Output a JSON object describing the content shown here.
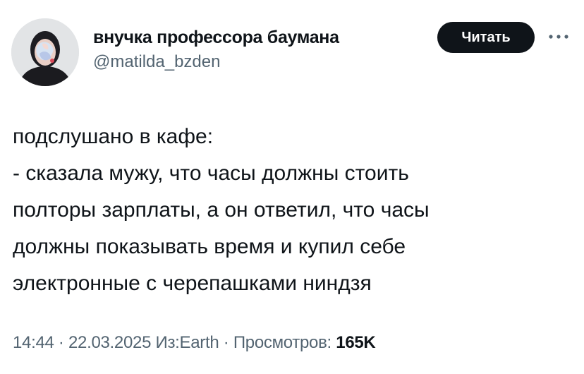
{
  "author": {
    "display_name": "внучка профессора баумана",
    "handle": "@matilda_bzden",
    "avatar_icon": "profile-photo-avatar"
  },
  "actions": {
    "follow_label": "Читать",
    "more_icon": "more-dots-icon"
  },
  "tweet": {
    "lines": [
      "подслушано в кафе:",
      "- сказала мужу, что часы должны стоить",
      "полторы зарплаты, а он ответил, что часы",
      "должны показывать время и купил себе",
      "электронные с черепашками ниндзя"
    ]
  },
  "meta": {
    "time": "14:44",
    "separator": " · ",
    "date": "22.03.2025",
    "source": "Из:Earth",
    "views_label": "Просмотров:",
    "views_count": "165K"
  },
  "colors": {
    "text_primary": "#0f1419",
    "text_secondary": "#536471",
    "button_bg": "#0f1419",
    "button_text": "#ffffff"
  }
}
